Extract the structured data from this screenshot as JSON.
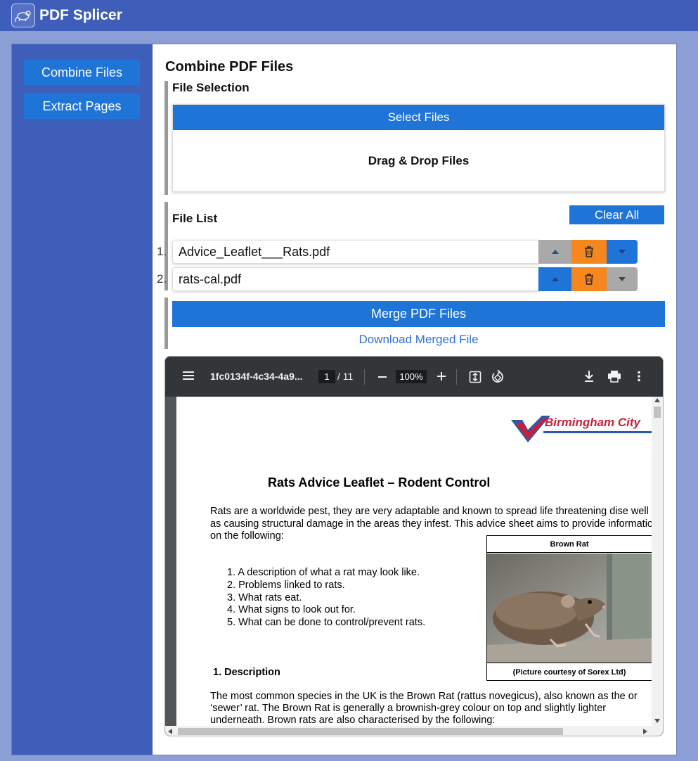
{
  "app": {
    "title": "PDF Splicer",
    "logo_icon": "rat-logo-icon"
  },
  "sidebar": {
    "items": [
      {
        "label": "Combine Files"
      },
      {
        "label": "Extract Pages"
      }
    ]
  },
  "main": {
    "title": "Combine PDF Files",
    "file_selection": {
      "title": "File Selection",
      "select_label": "Select Files",
      "drop_label": "Drag & Drop Files"
    },
    "file_list": {
      "title": "File List",
      "clear_label": "Clear All",
      "files": [
        {
          "num": "1.",
          "name": "Advice_Leaflet___Rats.pdf"
        },
        {
          "num": "2.",
          "name": "rats-cal.pdf"
        }
      ]
    },
    "merge_label": "Merge PDF Files",
    "download_label": "Download Merged File"
  },
  "viewer": {
    "file_name": "1fc0134f-4c34-4a9...",
    "page_current": "1",
    "page_total": "/ 11",
    "zoom": "100%",
    "document": {
      "brand": "Birmingham City",
      "title": "Rats Advice Leaflet – Rodent Control",
      "intro": "Rats are a worldwide pest, they are very adaptable and known to spread life threatening dise well as causing structural damage in the areas they infest. This advice sheet aims to provide information on the following:",
      "list": [
        "1. A description of what a rat may look like.",
        "2. Problems linked to rats.",
        "3. What rats eat.",
        "4. What signs to look out for.",
        "5. What can be done to control/prevent rats."
      ],
      "figure_caption_top": "Brown Rat",
      "figure_caption_bottom": "(Picture courtesy of Sorex Ltd)",
      "section1_heading": "1. Description",
      "section1_body": "The most common species in the UK is the Brown Rat (rattus novegicus), also known as the or ‘sewer’ rat. The Brown Rat is generally a brownish-grey colour on top and slightly lighter underneath. Brown rats are also characterised by the following:"
    }
  },
  "colors": {
    "topbar": "#3f5eb9",
    "primary": "#1f74d8",
    "delete": "#f6861e",
    "disabled": "#a9a9a9"
  }
}
